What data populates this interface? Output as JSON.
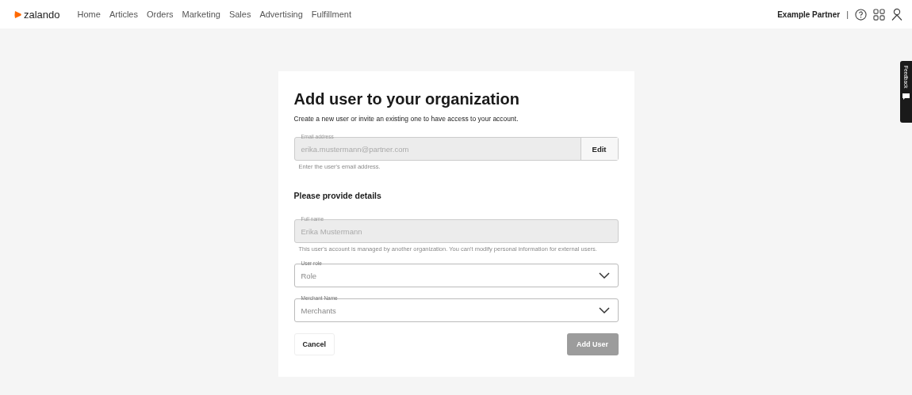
{
  "brand": {
    "name": "zalando"
  },
  "nav": [
    "Home",
    "Articles",
    "Orders",
    "Marketing",
    "Sales",
    "Advertising",
    "Fulfillment"
  ],
  "account": {
    "name": "Example Partner",
    "separator": "|"
  },
  "feedback": {
    "label": "Feedback"
  },
  "form": {
    "title": "Add user to your organization",
    "subtitle": "Create a new user or invite an existing one to have access to your account.",
    "email": {
      "label": "Email address",
      "value": "erika.mustermann@partner.com",
      "disabled": true,
      "button": "Edit",
      "hint": "Enter the user's email address."
    },
    "section": "Please provide details",
    "fields": [
      {
        "kind": "text",
        "label": "Full name",
        "value": "Erika Mustermann",
        "disabled": true,
        "hint": "This user's account is managed by another organization. You can't modify personal information for external users."
      },
      {
        "kind": "select",
        "label": "User role",
        "placeholder": "Role",
        "disabled": false
      },
      {
        "kind": "select",
        "label": "Merchant Name",
        "placeholder": "Merchants",
        "disabled": false
      }
    ],
    "cancel": "Cancel",
    "submit": {
      "label": "Add User",
      "disabled": true
    }
  }
}
